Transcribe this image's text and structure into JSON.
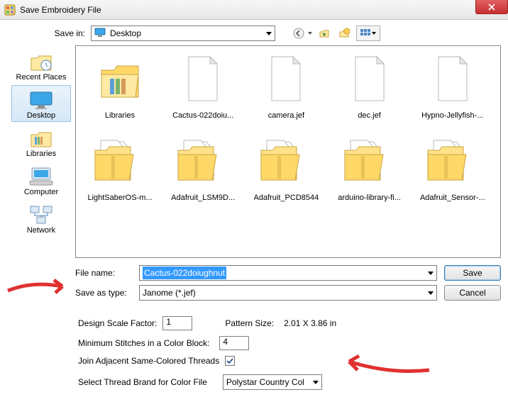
{
  "title": "Save Embroidery File",
  "savein": {
    "label": "Save in:",
    "value": "Desktop"
  },
  "places": [
    {
      "id": "recent",
      "label": "Recent Places"
    },
    {
      "id": "desktop",
      "label": "Desktop",
      "selected": true
    },
    {
      "id": "libraries",
      "label": "Libraries"
    },
    {
      "id": "computer",
      "label": "Computer"
    },
    {
      "id": "network",
      "label": "Network"
    }
  ],
  "files": [
    {
      "name": "Libraries",
      "kind": "libraries"
    },
    {
      "name": "Cactus-022doiu...",
      "kind": "page"
    },
    {
      "name": "camera.jef",
      "kind": "page"
    },
    {
      "name": "dec.jef",
      "kind": "page"
    },
    {
      "name": "Hypno-Jellyfish-...",
      "kind": "page"
    },
    {
      "name": "LightSaberOS-m...",
      "kind": "zip"
    },
    {
      "name": "Adafruit_LSM9D...",
      "kind": "zip"
    },
    {
      "name": "Adafruit_PCD8544",
      "kind": "zip"
    },
    {
      "name": "arduino-library-fi...",
      "kind": "zip"
    },
    {
      "name": "Adafruit_Sensor-...",
      "kind": "zip"
    }
  ],
  "form": {
    "filename_label": "File name:",
    "filename_value": "Cactus-022doiughnut",
    "savetype_label": "Save as type:",
    "savetype_value": "Janome (*.jef)",
    "save_btn": "Save",
    "cancel_btn": "Cancel"
  },
  "opts": {
    "scale_label": "Design Scale Factor:",
    "scale_value": "1",
    "pattern_label": "Pattern Size:",
    "pattern_value": "2.01 X 3.86 in",
    "minstitch_label": "Minimum Stitches in a Color Block:",
    "minstitch_value": "4",
    "join_label": "Join Adjacent Same-Colored Threads",
    "join_checked": true,
    "thread_label": "Select Thread Brand for Color File",
    "thread_value": "Polystar Country Col"
  }
}
